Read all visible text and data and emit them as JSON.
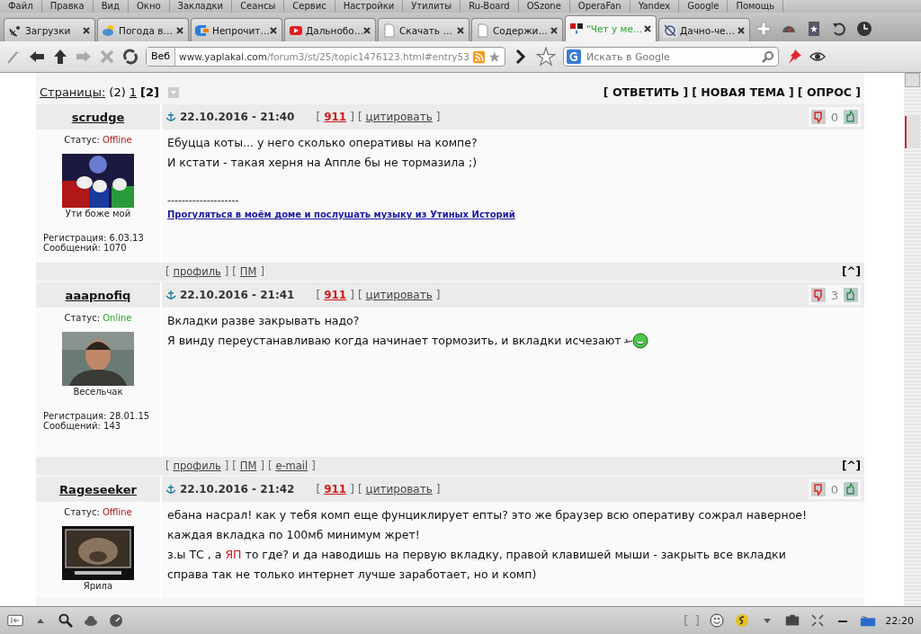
{
  "menu": [
    "Файл",
    "Правка",
    "Вид",
    "Окно",
    "Закладки",
    "Сеансы",
    "Сервис",
    "Настройки",
    "Утилиты",
    "Ru-Board",
    "OSzone",
    "OperaFan",
    "Yandex",
    "Google",
    "Помощь"
  ],
  "tabs": [
    {
      "label": "Загрузки",
      "kind": "satellite",
      "selected": false
    },
    {
      "label": "Погода в…",
      "kind": "weather",
      "selected": false
    },
    {
      "label": "Непрочит…",
      "kind": "brand",
      "selected": false
    },
    {
      "label": "Дальнобо…",
      "kind": "video",
      "selected": false
    },
    {
      "label": "Скачать …",
      "kind": "page",
      "selected": false
    },
    {
      "label": "Содержи…",
      "kind": "page",
      "selected": false
    },
    {
      "label": "\"Чет у ме…",
      "kind": "site",
      "selected": true
    },
    {
      "label": "Дачно-че…",
      "kind": "target",
      "selected": false
    }
  ],
  "address": {
    "badge": "Веб",
    "host": "www.yaplakal.com",
    "path": "/forum3/st/25/topic1476123.html#entry53"
  },
  "search": {
    "placeholder": "Искать в Google"
  },
  "pager": {
    "label": "Страницы:",
    "count": "(2)",
    "pages": [
      {
        "label": "1",
        "selected": false
      },
      {
        "label": "[2]",
        "selected": true
      }
    ],
    "actions": [
      "[ ОТВЕТИТЬ ]",
      "[ НОВАЯ ТЕМА ]",
      "[ ОПРОС ]"
    ]
  },
  "posts": [
    {
      "author": "scrudge",
      "status_label": "Статус:",
      "status": "Offline",
      "online": false,
      "avatar": {
        "kind": "picture"
      },
      "avatar_caption": "Ути боже мой",
      "registration": "Регистрация: 6.03.13",
      "messages": "Сообщений: 1070",
      "date": "22.10.2016 - 21:40",
      "number": {
        "pre": "[",
        "label": "911",
        "post": "]"
      },
      "quote": {
        "pre": "[",
        "label": "цитировать",
        "post": "]"
      },
      "votes": "0",
      "lines": [
        {
          "parts": [
            {
              "text": "Ебуцца коты... у него сколько оперативы на компе?",
              "accent": false
            }
          ],
          "smiley": false
        },
        {
          "parts": [
            {
              "text": "И кстати - такая херня на Аппле бы не тормазила ;)",
              "accent": false
            }
          ],
          "smiley": false
        }
      ],
      "signature": {
        "rule": "--------------------",
        "link": "Прогуляться в моём доме и послушать музыку из Утиных Историй"
      },
      "footer": [
        {
          "pre": "[",
          "label": "профиль",
          "post": "]"
        },
        {
          "pre": "[",
          "label": "ПМ",
          "post": "]"
        }
      ],
      "top": "[^]"
    },
    {
      "author": "aaapnofiq",
      "status_label": "Статус:",
      "status": "Online",
      "online": true,
      "avatar": {
        "kind": "picture"
      },
      "avatar_caption": "Весельчак",
      "registration": "Регистрация: 28.01.15",
      "messages": "Сообщений: 143",
      "date": "22.10.2016 - 21:41",
      "number": {
        "pre": "[",
        "label": "911",
        "post": "]"
      },
      "quote": {
        "pre": "[",
        "label": "цитировать",
        "post": "]"
      },
      "votes": "3",
      "lines": [
        {
          "parts": [
            {
              "text": "Вкладки разве закрывать надо?",
              "accent": false
            }
          ],
          "smiley": false
        },
        {
          "parts": [
            {
              "text": "Я винду переустанавливаю когда начинает тормозить, и вкладки исчезают",
              "accent": false
            }
          ],
          "smiley": true
        }
      ],
      "footer": [
        {
          "pre": "[",
          "label": "профиль",
          "post": "]"
        },
        {
          "pre": "[",
          "label": "ПМ",
          "post": "]"
        },
        {
          "pre": "[",
          "label": "e-mail",
          "post": "]"
        }
      ],
      "top": "[^]"
    },
    {
      "author": "Rageseeker",
      "status_label": "Статус:",
      "status": "Offline",
      "online": false,
      "avatar": {
        "kind": "picture"
      },
      "avatar_caption": "Ярила",
      "date": "22.10.2016 - 21:42",
      "number": {
        "pre": "[",
        "label": "911",
        "post": "]"
      },
      "quote": {
        "pre": "[",
        "label": "цитировать",
        "post": "]"
      },
      "votes": "0",
      "lines": [
        {
          "parts": [
            {
              "text": "ебана насрал! как у тебя комп еще фунциклирует епты? это же браузер всю оперативу сожрал наверное!",
              "accent": false
            }
          ],
          "smiley": false
        },
        {
          "parts": [
            {
              "text": "каждая вкладка по 100мб минимум жрет!",
              "accent": false
            }
          ],
          "smiley": false
        },
        {
          "parts": [
            {
              "text": "з.ы ТС , а ",
              "accent": false
            },
            {
              "text": "ЯП",
              "accent": true
            },
            {
              "text": " то где? и да наводишь на первую вкладку, правой клавишей мыши - закрыть все вкладки",
              "accent": false
            }
          ],
          "smiley": false
        },
        {
          "parts": [
            {
              "text": "справа так не только интернет лучше заработает, но и комп)",
              "accent": false
            }
          ],
          "smiley": false
        }
      ]
    }
  ],
  "status_bar": {
    "time": "22:20"
  }
}
